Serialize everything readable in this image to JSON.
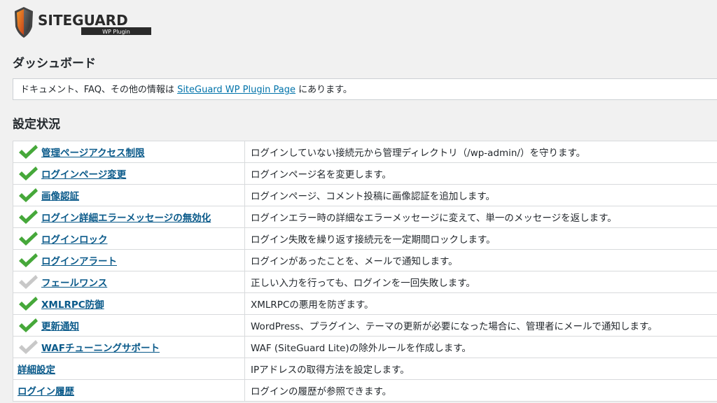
{
  "logo": {
    "name": "SITEGUARD",
    "sub": "WP Plugin"
  },
  "page_title": "ダッシュボード",
  "notice": {
    "before": "ドキュメント、FAQ、その他の情報は ",
    "link": "SiteGuard WP Plugin Page",
    "after": " にあります。"
  },
  "section_title": "設定状況",
  "colors": {
    "check_on": "#46a83a",
    "check_off": "#c8c8c8",
    "link": "#0a5a8a"
  },
  "rows": [
    {
      "label": "管理ページアクセス制限",
      "status": "on",
      "desc": "ログインしていない接続元から管理ディレクトリ（/wp-admin/）を守ります。"
    },
    {
      "label": "ログインページ変更",
      "status": "on",
      "desc": "ログインページ名を変更します。"
    },
    {
      "label": "画像認証",
      "status": "on",
      "desc": "ログインページ、コメント投稿に画像認証を追加します。"
    },
    {
      "label": "ログイン詳細エラーメッセージの無効化",
      "status": "on",
      "desc": "ログインエラー時の詳細なエラーメッセージに変えて、単一のメッセージを返します。"
    },
    {
      "label": "ログインロック",
      "status": "on",
      "desc": "ログイン失敗を繰り返す接続元を一定期間ロックします。"
    },
    {
      "label": "ログインアラート",
      "status": "on",
      "desc": "ログインがあったことを、メールで通知します。"
    },
    {
      "label": "フェールワンス",
      "status": "off",
      "desc": "正しい入力を行っても、ログインを一回失敗します。"
    },
    {
      "label": "XMLRPC防御",
      "status": "on",
      "desc": "XMLRPCの悪用を防ぎます。"
    },
    {
      "label": "更新通知",
      "status": "on",
      "desc": "WordPress、プラグイン、テーマの更新が必要になった場合に、管理者にメールで通知します。"
    },
    {
      "label": "WAFチューニングサポート",
      "status": "off",
      "desc": "WAF (SiteGuard Lite)の除外ルールを作成します。"
    },
    {
      "label": "詳細設定",
      "status": "none",
      "desc": "IPアドレスの取得方法を設定します。"
    },
    {
      "label": "ログイン履歴",
      "status": "none",
      "desc": "ログインの履歴が参照できます。"
    }
  ]
}
